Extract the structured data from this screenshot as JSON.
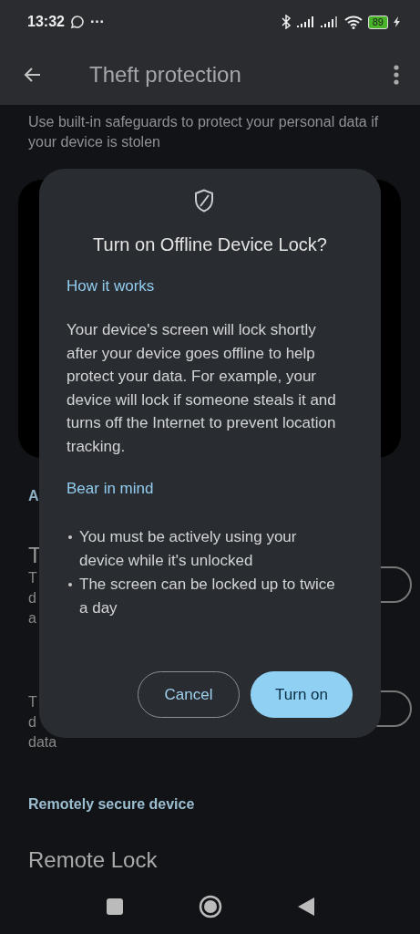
{
  "status_bar": {
    "time": "13:32",
    "more": "···",
    "battery": "89"
  },
  "app_bar": {
    "title": "Theft protection"
  },
  "subtitle": "Use built-in safeguards to protect your personal data if your device is stolen",
  "covered_section": {
    "heading": "A",
    "items": [
      {
        "title": "T",
        "on": false,
        "description": [
          "T",
          "d",
          "a"
        ]
      },
      {
        "on": false,
        "description": [
          "T",
          "d",
          "data"
        ]
      }
    ]
  },
  "remote_section": {
    "heading": "Remotely secure device",
    "item_title": "Remote Lock"
  },
  "dialog": {
    "title": "Turn on Offline Device Lock?",
    "sections": [
      {
        "kind": "paragraph",
        "heading": "How it works",
        "text": "Your device's screen will lock shortly after your device goes offline to help protect your data. For example, your device will lock if someone steals it and turns off the Internet to prevent location tracking."
      },
      {
        "kind": "bullets",
        "heading": "Bear in mind",
        "items": [
          "You must be actively using your device while it's unlocked",
          "The screen can be locked up to twice a day"
        ]
      }
    ],
    "buttons": [
      {
        "kind": "outlined",
        "label": "Cancel"
      },
      {
        "kind": "filled",
        "label": "Turn on"
      }
    ]
  }
}
